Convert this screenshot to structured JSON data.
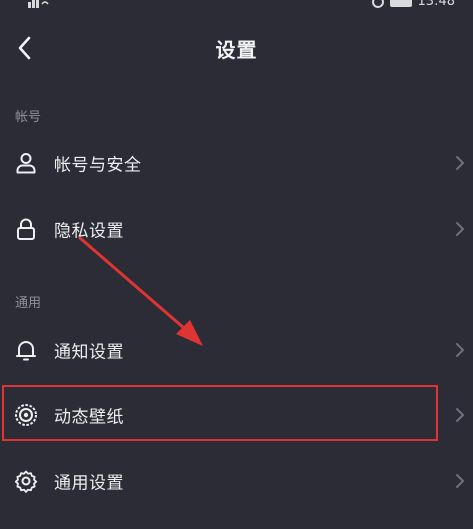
{
  "status_bar": {
    "time": "13:48"
  },
  "header": {
    "title": "设置"
  },
  "sections": {
    "account": {
      "label": "帐号",
      "items": [
        {
          "label": "帐号与安全",
          "icon": "user-icon"
        },
        {
          "label": "隐私设置",
          "icon": "lock-icon"
        }
      ]
    },
    "general": {
      "label": "通用",
      "items": [
        {
          "label": "通知设置",
          "icon": "bell-icon"
        },
        {
          "label": "动态壁纸",
          "icon": "live-wallpaper-icon"
        },
        {
          "label": "通用设置",
          "icon": "gear-icon"
        }
      ]
    }
  },
  "annotation": {
    "highlight_color": "#e03434"
  },
  "colors": {
    "background": "#2b2c35",
    "text": "#eeeff2",
    "section_label": "#8e9099",
    "chevron": "#6e707a"
  }
}
